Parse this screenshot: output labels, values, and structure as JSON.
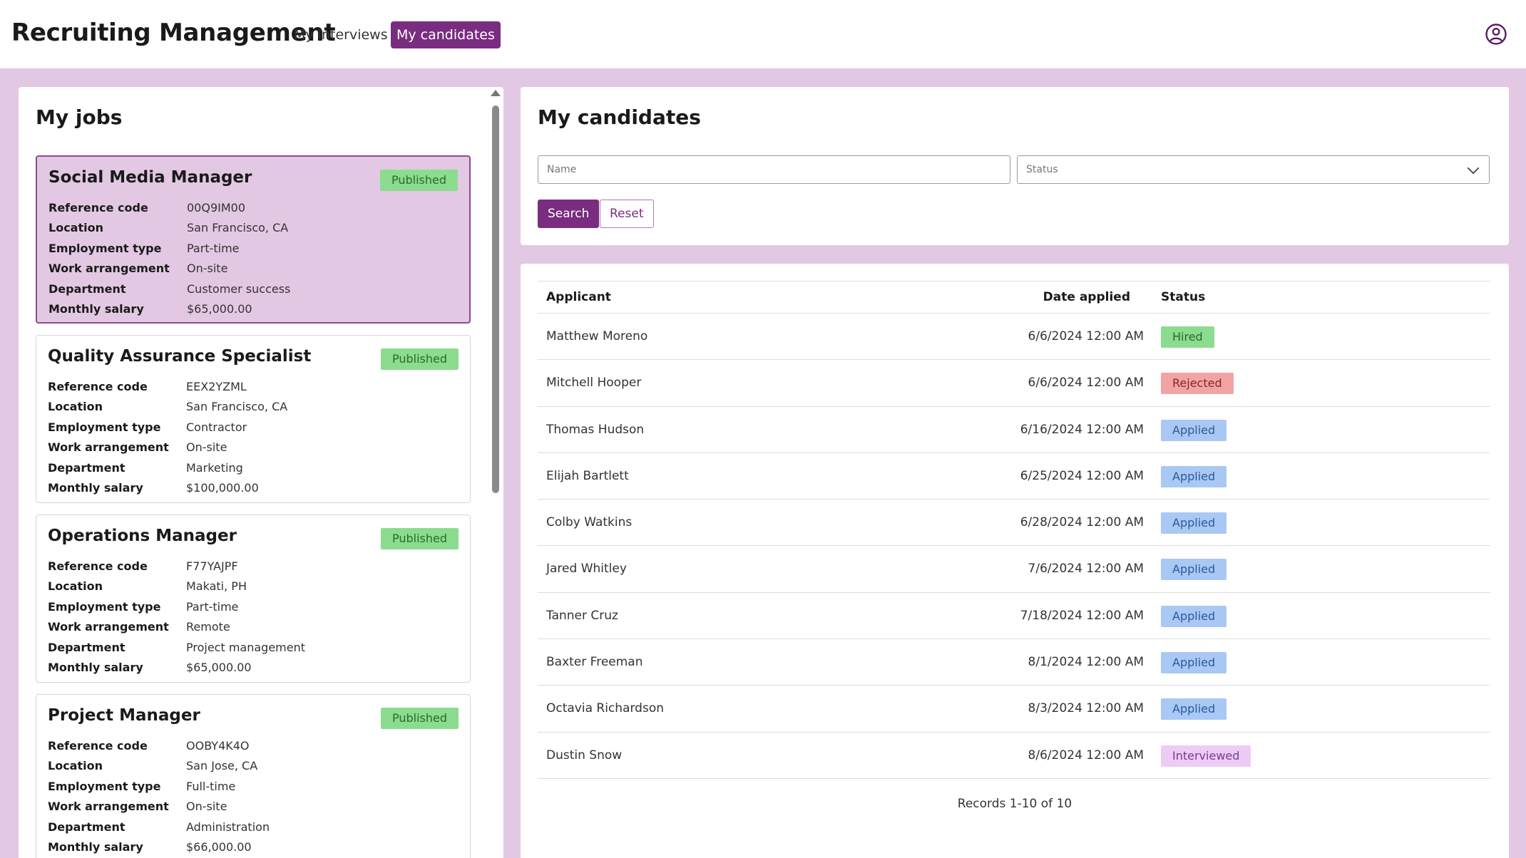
{
  "app": {
    "title": "Recruiting Management",
    "nav": [
      {
        "label": "My interviews",
        "active": false
      },
      {
        "label": "My candidates",
        "active": true
      }
    ],
    "user_icon": "user-circle-icon",
    "colors": {
      "accent": "#7a2c80",
      "background": "#e2c8e2",
      "published": "#8bdc8e",
      "hired": "#8bdc8e",
      "rejected": "#f2a4a4",
      "applied": "#a9c8f3",
      "interviewed": "#ecccf5"
    }
  },
  "jobs": {
    "title": "My jobs",
    "field_labels": {
      "reference_code": "Reference code",
      "location": "Location",
      "employment_type": "Employment type",
      "work_arrangement": "Work arrangement",
      "department": "Department",
      "monthly_salary": "Monthly salary"
    },
    "items": [
      {
        "title": "Social Media Manager",
        "status": "Published",
        "reference_code": "00Q9IM00",
        "location": "San Francisco, CA",
        "employment_type": "Part-time",
        "work_arrangement": "On-site",
        "department": "Customer success",
        "monthly_salary": "$65,000.00",
        "selected": true
      },
      {
        "title": "Quality Assurance Specialist",
        "status": "Published",
        "reference_code": "EEX2YZML",
        "location": "San Francisco, CA",
        "employment_type": "Contractor",
        "work_arrangement": "On-site",
        "department": "Marketing",
        "monthly_salary": "$100,000.00",
        "selected": false
      },
      {
        "title": "Operations Manager",
        "status": "Published",
        "reference_code": "F77YAJPF",
        "location": "Makati, PH",
        "employment_type": "Part-time",
        "work_arrangement": "Remote",
        "department": "Project management",
        "monthly_salary": "$65,000.00",
        "selected": false
      },
      {
        "title": "Project Manager",
        "status": "Published",
        "reference_code": "OOBY4K4O",
        "location": "San Jose, CA",
        "employment_type": "Full-time",
        "work_arrangement": "On-site",
        "department": "Administration",
        "monthly_salary": "$66,000.00",
        "selected": false
      }
    ]
  },
  "candidates": {
    "title": "My candidates",
    "search": {
      "name_placeholder": "Name",
      "name_value": "",
      "status_placeholder": "Status",
      "search_label": "Search",
      "reset_label": "Reset"
    },
    "columns": {
      "applicant": "Applicant",
      "date_applied": "Date applied",
      "status": "Status"
    },
    "rows": [
      {
        "applicant": "Matthew Moreno",
        "date_applied": "6/6/2024 12:00 AM",
        "status": "Hired"
      },
      {
        "applicant": "Mitchell Hooper",
        "date_applied": "6/6/2024 12:00 AM",
        "status": "Rejected"
      },
      {
        "applicant": "Thomas Hudson",
        "date_applied": "6/16/2024 12:00 AM",
        "status": "Applied"
      },
      {
        "applicant": "Elijah Bartlett",
        "date_applied": "6/25/2024 12:00 AM",
        "status": "Applied"
      },
      {
        "applicant": "Colby Watkins",
        "date_applied": "6/28/2024 12:00 AM",
        "status": "Applied"
      },
      {
        "applicant": "Jared Whitley",
        "date_applied": "7/6/2024 12:00 AM",
        "status": "Applied"
      },
      {
        "applicant": "Tanner Cruz",
        "date_applied": "7/18/2024 12:00 AM",
        "status": "Applied"
      },
      {
        "applicant": "Baxter Freeman",
        "date_applied": "8/1/2024 12:00 AM",
        "status": "Applied"
      },
      {
        "applicant": "Octavia Richardson",
        "date_applied": "8/3/2024 12:00 AM",
        "status": "Applied"
      },
      {
        "applicant": "Dustin Snow",
        "date_applied": "8/6/2024 12:00 AM",
        "status": "Interviewed"
      }
    ],
    "records_text": "Records 1-10 of 10"
  }
}
